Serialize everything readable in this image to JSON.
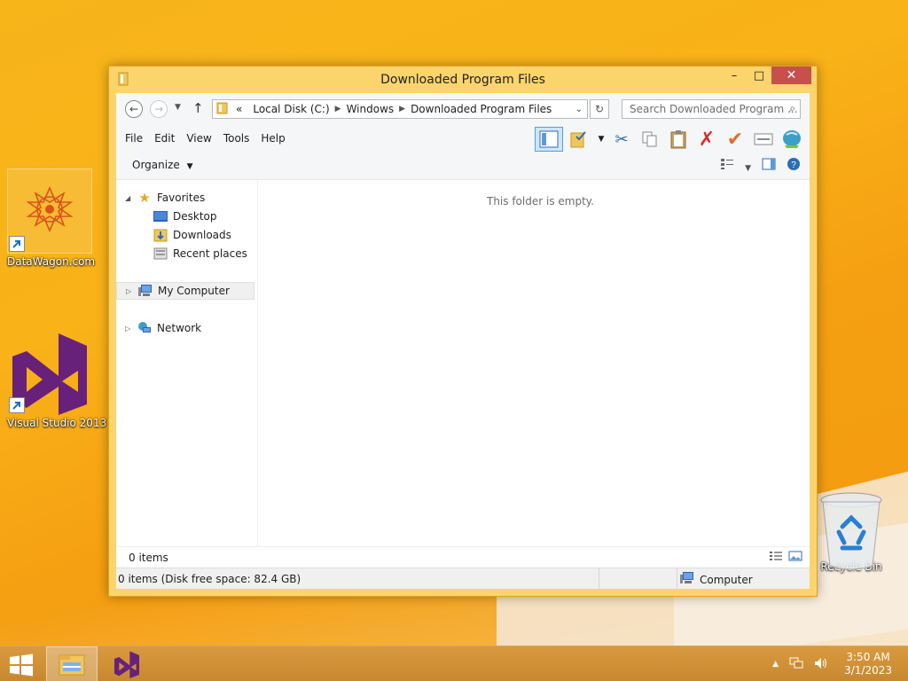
{
  "desktop": {
    "icons": [
      {
        "label": "DataWagon.com"
      },
      {
        "label": "Visual Studio 2013"
      },
      {
        "label": "Recycle Bin"
      }
    ]
  },
  "window": {
    "title": "Downloaded Program Files",
    "controls": {
      "minimize": "–",
      "maximize": "□",
      "close": "✕"
    },
    "address": {
      "overflow": "«",
      "segments": [
        "Local Disk (C:)",
        "Windows",
        "Downloaded Program Files"
      ]
    },
    "search": {
      "placeholder": "Search Downloaded Program ..."
    },
    "menu": [
      "File",
      "Edit",
      "View",
      "Tools",
      "Help"
    ],
    "organize_label": "Organize",
    "nav": {
      "favorites": "Favorites",
      "desktop": "Desktop",
      "downloads": "Downloads",
      "recent": "Recent places",
      "my_computer": "My Computer",
      "network": "Network"
    },
    "empty_message": "This folder is empty.",
    "items_count": "0 items",
    "status": {
      "left": "0 items (Disk free space: 82.4 GB)",
      "right": "Computer"
    }
  },
  "taskbar": {
    "time": "3:50 AM",
    "date": "3/1/2023"
  },
  "colors": {
    "desktop": "#f7b51a",
    "window_frame": "#fbd46c",
    "close_button": "#c7504b",
    "taskbar": "#d99a3f",
    "vs_purple": "#68217a"
  }
}
